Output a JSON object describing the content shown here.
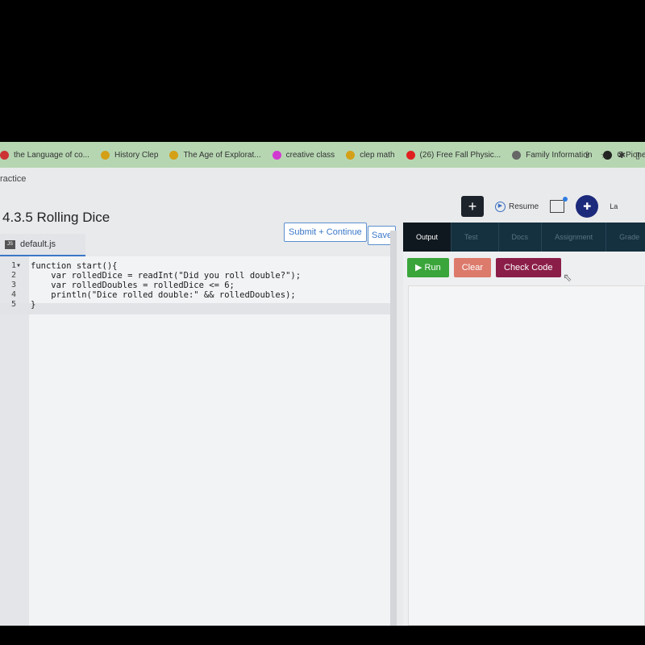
{
  "bookmarks": [
    {
      "label": "the Language of co...",
      "color": "#cc3333"
    },
    {
      "label": "History Clep",
      "color": "#d4a017"
    },
    {
      "label": "The Age of Explorat...",
      "color": "#d4a017"
    },
    {
      "label": "creative class",
      "color": "#d13ad1"
    },
    {
      "label": "clep math",
      "color": "#d4a017"
    },
    {
      "label": "(26) Free Fall Physic...",
      "color": "#e02020"
    },
    {
      "label": "Family Information",
      "color": "#666666"
    },
    {
      "label": "O Pioneers!",
      "color": "#222222"
    }
  ],
  "header": {
    "crumb": "ractice",
    "plus": "+",
    "resume": "Resume",
    "user": "La"
  },
  "assignment": {
    "title": "4.3.5 Rolling Dice",
    "submit": "Submit + Continue",
    "save": "Save"
  },
  "editor": {
    "filename": "default.js",
    "lines": [
      "function start(){",
      "    var rolledDice = readInt(\"Did you roll double?\");",
      "    var rolledDoubles = rolledDice <= 6;",
      "    println(\"Dice rolled double:\" && rolledDoubles);",
      "}"
    ]
  },
  "panel": {
    "tabs": [
      "Output",
      "Test Cases",
      "Docs",
      "Assignment",
      "Grade"
    ],
    "run": "Run",
    "clear": "Clear",
    "check": "Check Code"
  }
}
